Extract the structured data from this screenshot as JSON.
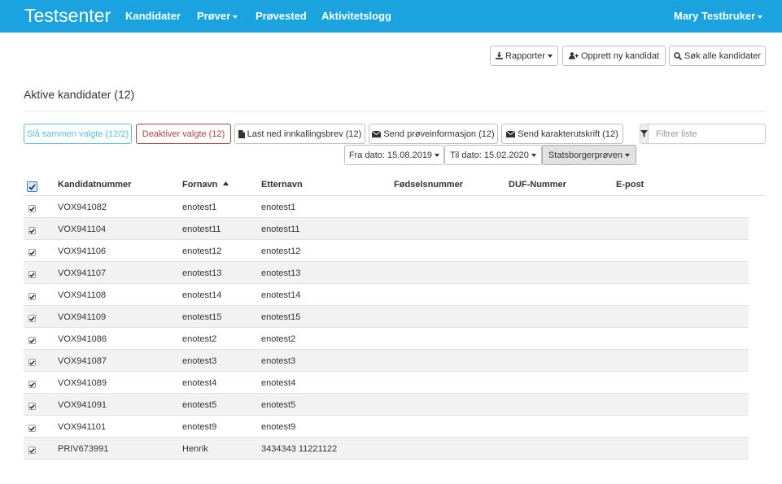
{
  "navbar": {
    "brand": "Testsenter",
    "items": [
      "Kandidater",
      "Prøver",
      "Prøvested",
      "Aktivitetslogg"
    ],
    "user": "Mary Testbruker"
  },
  "toolbar": {
    "reports": "Rapporter",
    "new_candidate": "Opprett ny kandidat",
    "search_all": "Søk alle kandidater"
  },
  "section": {
    "title": "Aktive kandidater (12)"
  },
  "actions": {
    "merge": "Slå sammen valgte (12/2)",
    "deactivate": "Deaktiver valgte (12)",
    "download_letter": "Last ned innkallingsbrev (12)",
    "send_info": "Send prøveinformasjon (12)",
    "send_transcript": "Send karakterutskrift (12)"
  },
  "filter": {
    "placeholder": "Filtrer liste"
  },
  "dates": {
    "from": "Fra dato: 15.08.2019",
    "to": "Til dato: 15.02.2020",
    "test": "Statsborgerprøven"
  },
  "icons": {
    "download": "download-icon",
    "add_user": "user-plus-icon",
    "search": "search-icon",
    "file": "file-icon",
    "envelope": "envelope-icon",
    "filter": "filter-icon",
    "sort": "sort-asc-icon"
  },
  "colors": {
    "navbar": "#1aa3de",
    "info": "#5bc0de",
    "danger": "#a94442"
  },
  "table": {
    "columns": [
      "Kandidatnummer",
      "Fornavn",
      "Etternavn",
      "Fødselsnummer",
      "DUF-Nummer",
      "E-post"
    ],
    "rows": [
      [
        "VOX941082",
        "enotest1",
        "enotest1"
      ],
      [
        "VOX941104",
        "enotest11",
        "enotest11"
      ],
      [
        "VOX941106",
        "enotest12",
        "enotest12"
      ],
      [
        "VOX941107",
        "enotest13",
        "enotest13"
      ],
      [
        "VOX941108",
        "enotest14",
        "enotest14"
      ],
      [
        "VOX941109",
        "enotest15",
        "enotest15"
      ],
      [
        "VOX941086",
        "enotest2",
        "enotest2"
      ],
      [
        "VOX941087",
        "enotest3",
        "enotest3"
      ],
      [
        "VOX941089",
        "enotest4",
        "enotest4"
      ],
      [
        "VOX941091",
        "enotest5",
        "enotest5"
      ],
      [
        "VOX941101",
        "enotest9",
        "enotest9"
      ],
      [
        "PRIV673991",
        "Henrik",
        "3434343 11221122"
      ]
    ]
  }
}
